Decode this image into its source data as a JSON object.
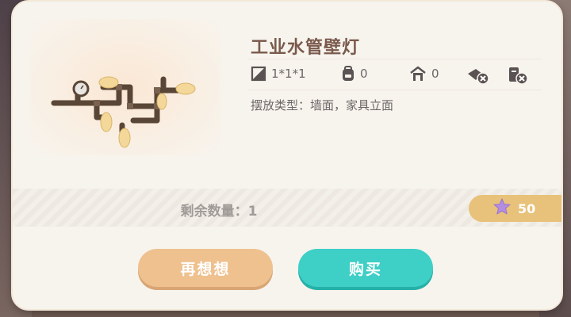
{
  "item": {
    "name": "工业水管壁灯",
    "size": "1*1*1",
    "backpack_count": "0",
    "home_count": "0",
    "placement": "摆放类型：墙面，家具立面"
  },
  "stats": {
    "size_icon": "size-cube-icon",
    "backpack_icon": "backpack-icon",
    "home_icon": "house-icon",
    "gift_disabled_icon": "gift-disabled-icon",
    "trade_disabled_icon": "trade-disabled-icon"
  },
  "purchase": {
    "remaining": "剩余数量：1",
    "price": "50",
    "currency_icon": "star-icon",
    "think_label": "再想想",
    "buy_label": "购买"
  },
  "colors": {
    "buy": "#3ecfc6",
    "think": "#eec18f",
    "price_badge": "#e8c27a",
    "star": "#b38ee0"
  }
}
